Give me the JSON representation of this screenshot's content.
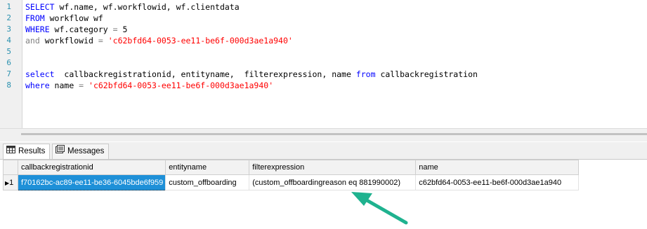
{
  "editor": {
    "lines": [
      {
        "num": "1",
        "tokens": [
          {
            "t": "SELECT",
            "c": "kw"
          },
          {
            "t": " wf.name, wf.workflowid, wf.clientdata",
            "c": "pl"
          }
        ]
      },
      {
        "num": "2",
        "tokens": [
          {
            "t": "FROM",
            "c": "kw"
          },
          {
            "t": " workflow wf",
            "c": "pl"
          }
        ]
      },
      {
        "num": "3",
        "tokens": [
          {
            "t": "WHERE",
            "c": "kw"
          },
          {
            "t": " wf.category ",
            "c": "pl"
          },
          {
            "t": "=",
            "c": "gr"
          },
          {
            "t": " 5",
            "c": "pl"
          }
        ]
      },
      {
        "num": "4",
        "tokens": [
          {
            "t": "and",
            "c": "gr"
          },
          {
            "t": " workflowid ",
            "c": "pl"
          },
          {
            "t": "=",
            "c": "gr"
          },
          {
            "t": " 'c62bfd64-0053-ee11-be6f-000d3ae1a940'",
            "c": "str"
          }
        ]
      },
      {
        "num": "5",
        "tokens": []
      },
      {
        "num": "6",
        "tokens": []
      },
      {
        "num": "7",
        "tokens": [
          {
            "t": "select",
            "c": "kw"
          },
          {
            "t": "  callbackregistrationid, entityname,  filterexpression, name ",
            "c": "pl"
          },
          {
            "t": "from",
            "c": "kw"
          },
          {
            "t": " callbackregistration",
            "c": "pl"
          }
        ]
      },
      {
        "num": "8",
        "tokens": [
          {
            "t": "where",
            "c": "kw"
          },
          {
            "t": " name ",
            "c": "pl"
          },
          {
            "t": "=",
            "c": "gr"
          },
          {
            "t": " 'c62bfd64-0053-ee11-be6f-000d3ae1a940'",
            "c": "str"
          }
        ]
      }
    ]
  },
  "tabs": {
    "results_label": "Results",
    "messages_label": "Messages",
    "results_icon": "grid-icon",
    "messages_icon": "messages-icon"
  },
  "grid": {
    "columns": [
      "callbackregistrationid",
      "entityname",
      "filterexpression",
      "name"
    ],
    "rows": [
      {
        "row_number": "1",
        "cells": [
          "f70162bc-ac89-ee11-be36-6045bde6f959",
          "custom_offboarding",
          "(custom_offboardingreason eq 881990002)",
          "c62bfd64-0053-ee11-be6f-000d3ae1a940"
        ]
      }
    ]
  },
  "colors": {
    "keyword": "#0000ff",
    "string": "#ff0000",
    "operator": "#808080",
    "selection": "#1e90d8",
    "annotation_arrow": "#1fb28f"
  }
}
